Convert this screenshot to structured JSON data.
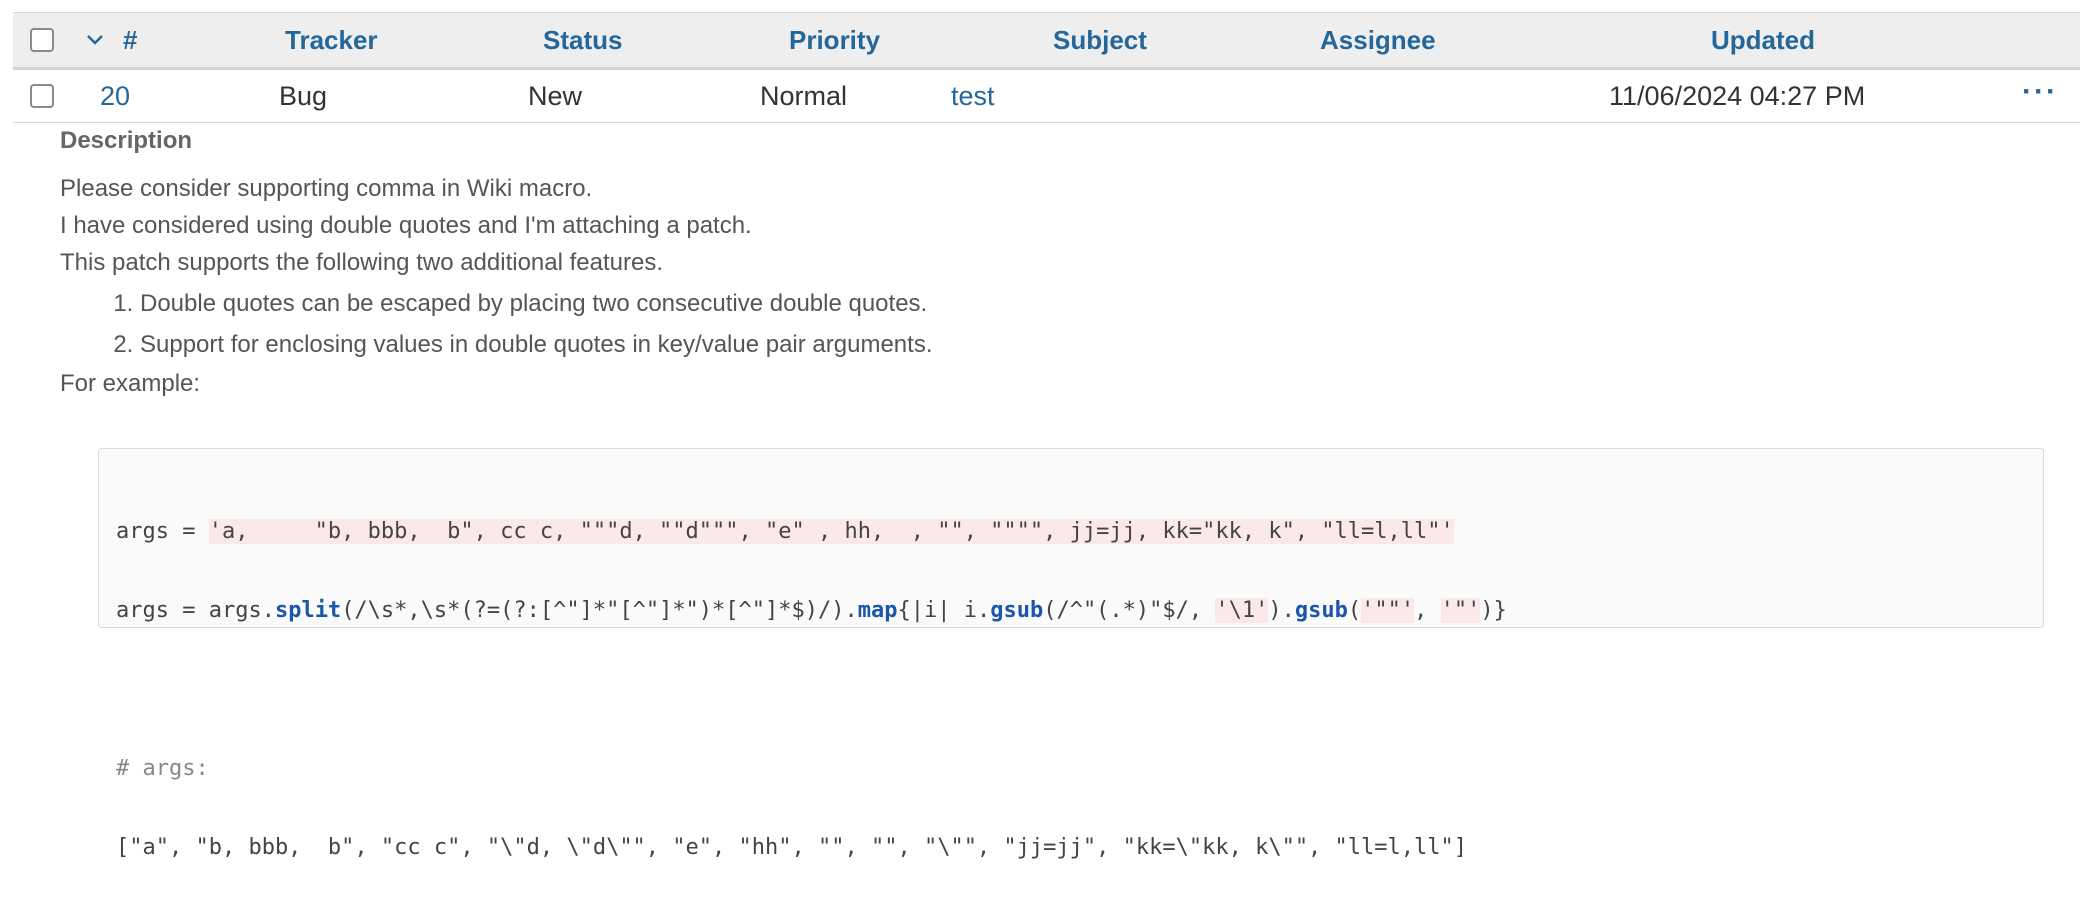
{
  "table": {
    "header": {
      "sort_col": "#",
      "tracker": "Tracker",
      "status": "Status",
      "priority": "Priority",
      "subject": "Subject",
      "assignee": "Assignee",
      "updated": "Updated"
    },
    "rows": [
      {
        "id": "20",
        "tracker": "Bug",
        "status": "New",
        "priority": "Normal",
        "subject": "test",
        "assignee": "",
        "updated": "11/06/2024 04:27 PM",
        "actions": "···"
      }
    ]
  },
  "description": {
    "title": "Description",
    "paragraphs": [
      "Please consider supporting comma in Wiki macro.",
      "I have considered using double quotes and I'm attaching a patch.",
      "This patch supports the following two additional features."
    ],
    "list": [
      "Double quotes can be escaped by placing two consecutive double quotes.",
      "Support for enclosing values in double quotes in key/value pair arguments."
    ],
    "example_label": "For example:"
  },
  "code": {
    "line1_prefix": "args = ",
    "line1_str": "'a,     \"b, bbb,  b\", cc c, \"\"\"d, \"\"d\"\"\", \"e\" , hh,  , \"\", \"\"\"\", jj=jj, kk=\"kk, k\", \"ll=l,ll\"'",
    "line2_a": "args = args.",
    "line2_split": "split",
    "line2_b": "(/\\s*,\\s*(?=(?:[^\"]*\"[^\"]*\")*[^\"]*$)/).",
    "line2_map": "map",
    "line2_c": "{|i| i.",
    "line2_gsub1": "gsub",
    "line2_d": "(/^\"(.*)\"$/, ",
    "line2_str1": "'\\1'",
    "line2_e": ").",
    "line2_gsub2": "gsub",
    "line2_f": "(",
    "line2_str2": "'\"\"'",
    "line2_g": ", ",
    "line2_str3": "'\"'",
    "line2_h": ")}",
    "comment": "# args:",
    "result": "[\"a\", \"b, bbb,  b\", \"cc c\", \"\\\"d, \\\"d\\\"\", \"e\", \"hh\", \"\", \"\", \"\\\"\", \"jj=jj\", \"kk=\\\"kk, k\\\"\", \"ll=l,ll\"]"
  }
}
